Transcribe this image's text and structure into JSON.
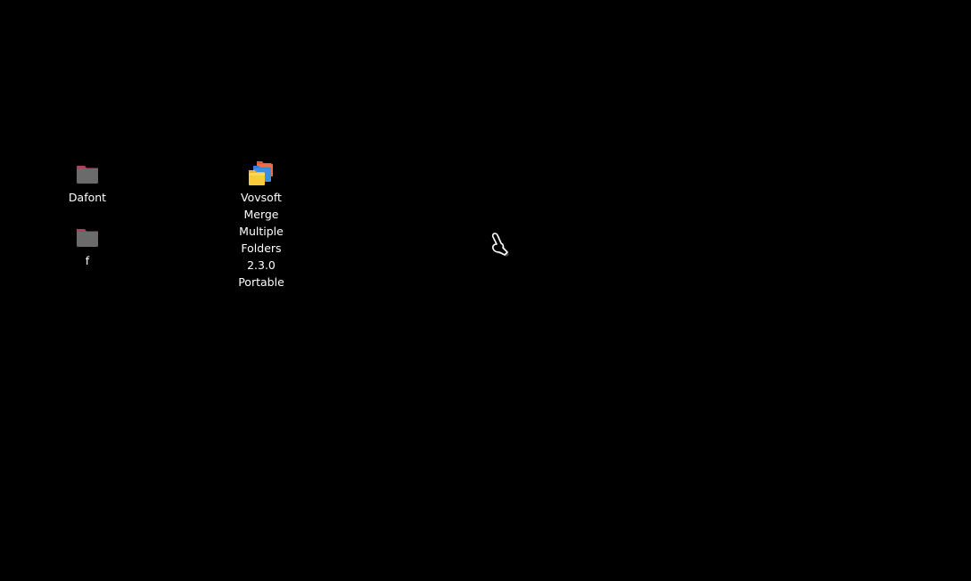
{
  "desktop": {
    "background_color": "#000000",
    "icons": [
      {
        "label": "Dafont",
        "icon": "folder-icon",
        "color": "#6b6b6b",
        "tab_color": "#a8435a"
      },
      {
        "label": "f",
        "icon": "folder-icon",
        "color": "#6b6b6b",
        "tab_color": "#a8435a"
      },
      {
        "label_lines": [
          "Vovsoft",
          "Merge",
          "Multiple",
          "Folders",
          "2.3.0",
          "Portable"
        ],
        "icon": "stacked-folders-icon"
      }
    ]
  },
  "cursor": {
    "icon": "hand-pointer-icon"
  }
}
